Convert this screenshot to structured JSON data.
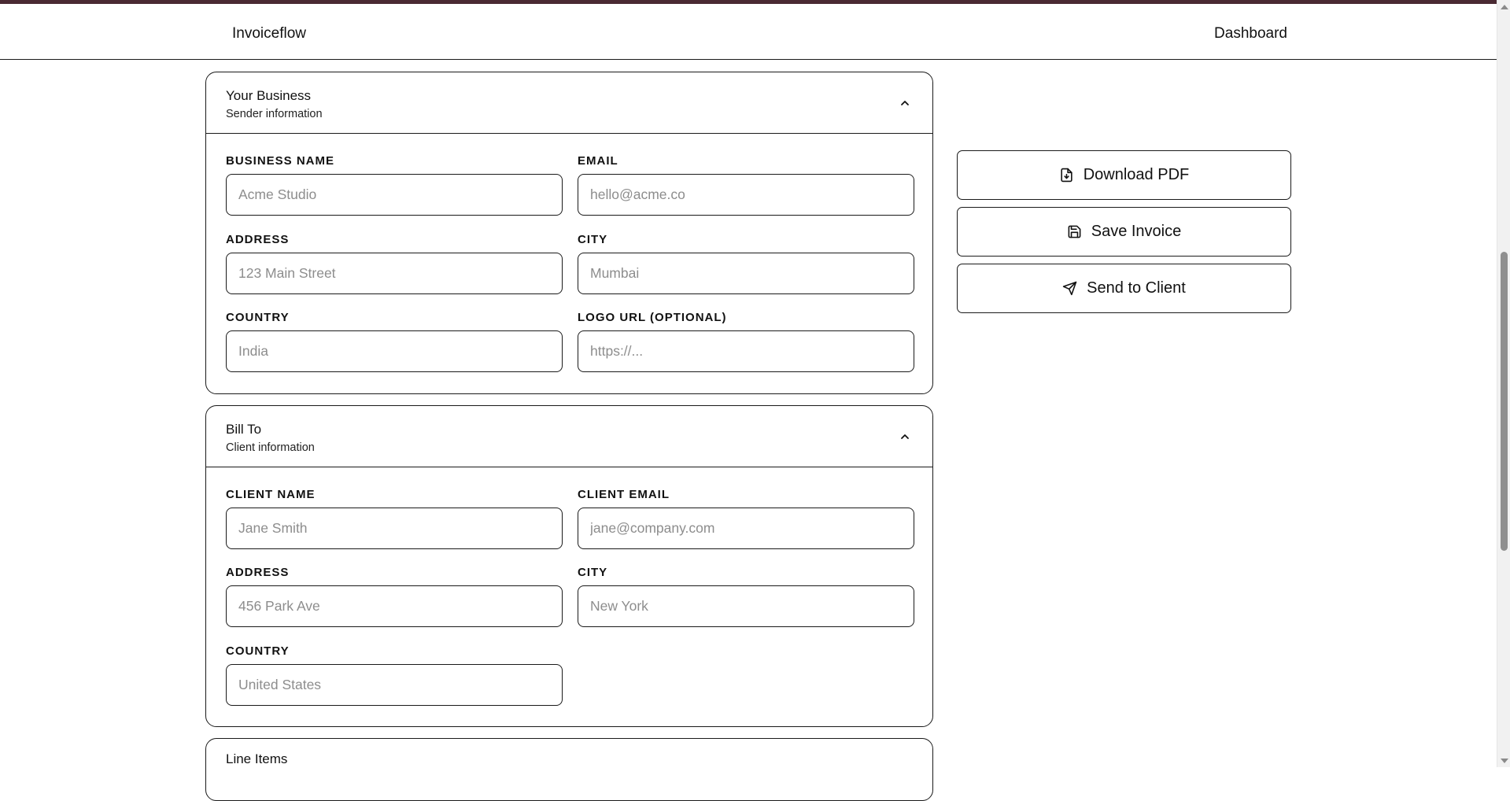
{
  "nav": {
    "brand": "Invoiceflow",
    "dashboard_link": "Dashboard"
  },
  "sender": {
    "title": "Your Business",
    "subtitle": "Sender information",
    "fields": {
      "business_name": {
        "label": "BUSINESS NAME",
        "placeholder": "Acme Studio",
        "value": ""
      },
      "email": {
        "label": "EMAIL",
        "placeholder": "hello@acme.co",
        "value": ""
      },
      "address": {
        "label": "ADDRESS",
        "placeholder": "123 Main Street",
        "value": ""
      },
      "city": {
        "label": "CITY",
        "placeholder": "Mumbai",
        "value": ""
      },
      "country": {
        "label": "COUNTRY",
        "placeholder": "India",
        "value": ""
      },
      "logo_url": {
        "label": "LOGO URL (OPTIONAL)",
        "placeholder": "https://...",
        "value": ""
      }
    }
  },
  "client": {
    "title": "Bill To",
    "subtitle": "Client information",
    "fields": {
      "client_name": {
        "label": "CLIENT NAME",
        "placeholder": "Jane Smith",
        "value": ""
      },
      "client_email": {
        "label": "CLIENT EMAIL",
        "placeholder": "jane@company.com",
        "value": ""
      },
      "address": {
        "label": "ADDRESS",
        "placeholder": "456 Park Ave",
        "value": ""
      },
      "city": {
        "label": "CITY",
        "placeholder": "New York",
        "value": ""
      },
      "country": {
        "label": "COUNTRY",
        "placeholder": "United States",
        "value": ""
      }
    }
  },
  "line_items": {
    "title": "Line Items"
  },
  "actions": {
    "download_pdf": "Download PDF",
    "save_invoice": "Save Invoice",
    "send_to_client": "Send to Client"
  },
  "icons": {
    "download": "file-download-icon",
    "save": "save-disk-icon",
    "send": "send-paper-plane-icon",
    "collapse": "chevron-up-icon"
  },
  "colors": {
    "top_accent": "#4a2a33",
    "border": "#1a1a1a",
    "placeholder": "#8d8d8d"
  }
}
